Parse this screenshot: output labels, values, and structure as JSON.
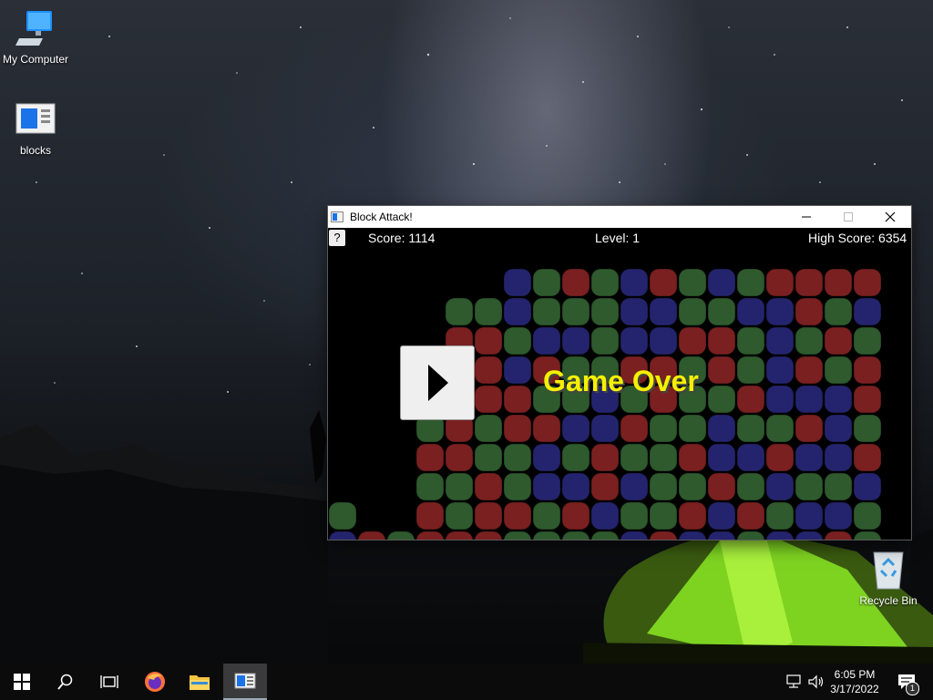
{
  "desktop": {
    "icons": [
      {
        "label": "My Computer",
        "icon": "computer-icon"
      },
      {
        "label": "blocks",
        "icon": "document-icon"
      },
      {
        "label": "Recycle Bin",
        "icon": "recycle-bin-icon"
      }
    ]
  },
  "window": {
    "title": "Block Attack!",
    "buttons": {
      "minimize": "minimize-icon",
      "maximize": "maximize-icon",
      "close": "close-icon"
    }
  },
  "game": {
    "help_label": "?",
    "score_text": "Score: 1114",
    "level_text": "Level: 1",
    "high_score_text": "High Score: 6354",
    "status_text": "Game Over",
    "play_button_icon": "play-icon",
    "colors": {
      "red": "#7a2020",
      "green": "#2e5a2e",
      "blue": "#24246e",
      "background": "#000000",
      "status": "#f5f000"
    },
    "grid": [
      "......BGRGBRGBGRRRR",
      "....GGBGGGBBGGBBRGB",
      "....RRGBBGBBRRGBGRG",
      "...RRRBRGGRRGRGBRGR",
      "...RGRRGGBGRGGRBBBR",
      "...GRGRRBBRGGBGGRBG",
      "...RRGGBGRGGRBBRBBR",
      "...GGRGBBRBGGRGBGGB",
      "G..RGRRGRBGGRBRGBBG",
      "BRGRRRGGGGBRBBGBBRG"
    ]
  },
  "taskbar": {
    "items": [
      "start-icon",
      "search-icon",
      "task-view-icon",
      "firefox-icon",
      "file-explorer-icon",
      "block-attack-icon"
    ],
    "tray": [
      "network-icon",
      "volume-icon",
      "notification-icon"
    ],
    "time": "6:05 PM",
    "date": "3/17/2022",
    "notification_count": "1"
  }
}
